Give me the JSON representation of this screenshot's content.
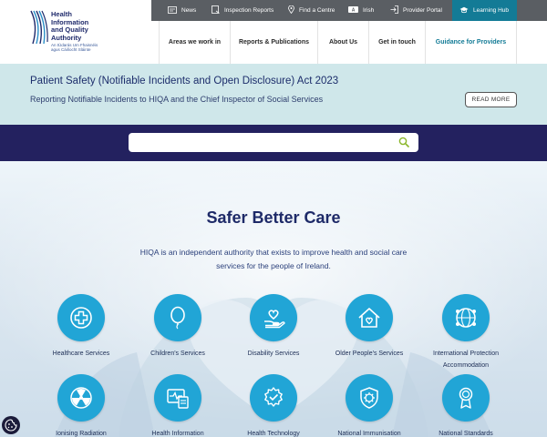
{
  "logo": {
    "lines": [
      "Health",
      "Information",
      "and Quality",
      "Authority"
    ],
    "irish": [
      "An tÚdarás Um Fhaisnéis",
      "agus Cáilíocht Sláinte"
    ]
  },
  "topbar": {
    "links": [
      {
        "label": "News",
        "icon": "newspaper-icon"
      },
      {
        "label": "Inspection Reports",
        "icon": "report-icon"
      },
      {
        "label": "Find a Centre",
        "icon": "location-pin-icon"
      },
      {
        "label": "Irish",
        "icon": "language-icon"
      },
      {
        "label": "Provider Portal",
        "icon": "login-icon"
      },
      {
        "label": "Learning Hub",
        "icon": "graduation-cap-icon"
      }
    ]
  },
  "nav": {
    "items": [
      {
        "label": "Areas we work in"
      },
      {
        "label": "Reports & Publications"
      },
      {
        "label": "About Us"
      },
      {
        "label": "Get in touch"
      },
      {
        "label": "Guidance for Providers"
      }
    ]
  },
  "banner": {
    "title": "Patient Safety (Notifiable Incidents and Open Disclosure) Act 2023",
    "subtitle": "Reporting Notifiable Incidents to HIQA and the Chief Inspector of Social Services",
    "button": "READ MORE"
  },
  "search": {
    "value": "",
    "placeholder": ""
  },
  "hero": {
    "title": "Safer Better Care",
    "description": "HIQA is an independent authority that exists to improve health and social care services for the people of Ireland."
  },
  "services": [
    {
      "label": "Healthcare Services",
      "icon": "medical-cross-icon"
    },
    {
      "label": "Children's Services",
      "icon": "balloon-icon"
    },
    {
      "label": "Disability Services",
      "icon": "heart-hand-icon"
    },
    {
      "label": "Older People's Services",
      "icon": "home-heart-icon"
    },
    {
      "label": "International Protection Accommodation",
      "icon": "globe-people-icon"
    },
    {
      "label": "Ionising Radiation",
      "icon": "radiation-icon"
    },
    {
      "label": "Health Information",
      "icon": "health-monitor-icon"
    },
    {
      "label": "Health Technology",
      "icon": "gear-check-icon"
    },
    {
      "label": "National Immunisation",
      "icon": "shield-virus-icon"
    },
    {
      "label": "National Standards",
      "icon": "award-ribbon-icon"
    }
  ],
  "colors": {
    "navy": "#23215f",
    "teal": "#137b96",
    "service_blue": "#21a5d6",
    "banner_bg": "#cfe7ea",
    "topbar_bg": "#5a5e63"
  }
}
